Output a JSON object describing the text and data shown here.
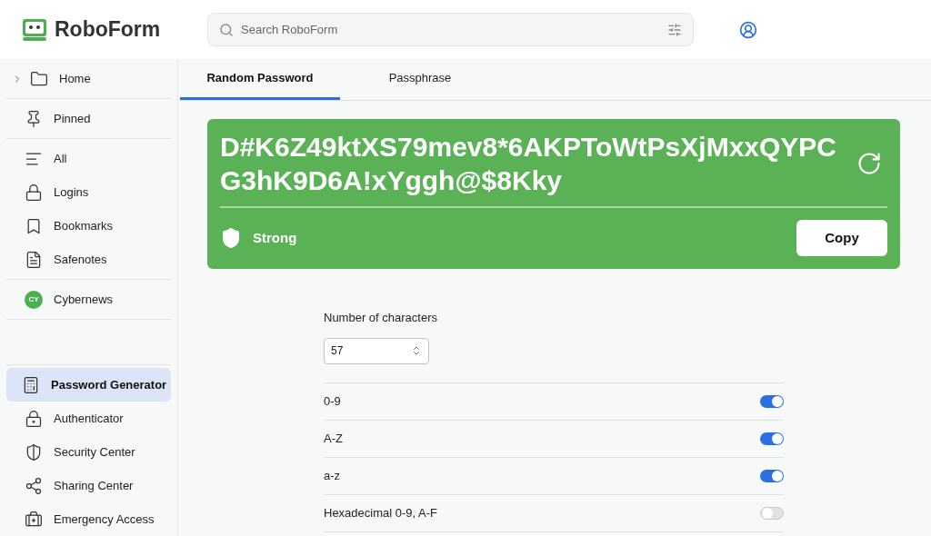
{
  "brand": "RoboForm",
  "search": {
    "placeholder": "Search RoboForm"
  },
  "sidebar": {
    "sections": [
      {
        "items": [
          {
            "label": "Home",
            "expandable": true,
            "selected": false
          }
        ]
      },
      {
        "items": [
          {
            "label": "Pinned",
            "expandable": false,
            "selected": false
          }
        ]
      },
      {
        "items": [
          {
            "label": "All",
            "expandable": false,
            "selected": false
          },
          {
            "label": "Logins",
            "expandable": false,
            "selected": false
          },
          {
            "label": "Bookmarks",
            "expandable": false,
            "selected": false
          },
          {
            "label": "Safenotes",
            "expandable": false,
            "selected": false
          }
        ]
      },
      {
        "items": [
          {
            "label": "Cybernews",
            "kind": "avatar",
            "avatar": "CY",
            "color": "#4caf50",
            "expandable": false,
            "selected": false
          }
        ]
      },
      {
        "items": [
          {
            "label": "Password Generator",
            "expandable": false,
            "selected": true
          },
          {
            "label": "Authenticator",
            "expandable": false,
            "selected": false
          },
          {
            "label": "Security Center",
            "expandable": false,
            "selected": false
          },
          {
            "label": "Sharing Center",
            "expandable": false,
            "selected": false
          },
          {
            "label": "Emergency Access",
            "expandable": false,
            "selected": false
          }
        ]
      }
    ]
  },
  "tabs": [
    {
      "label": "Random Password",
      "selected": true
    },
    {
      "label": "Passphrase",
      "selected": false
    }
  ],
  "generated": {
    "password": "D#K6Z49ktXS79mev8*6AKPToWtPsXjMxxQYPCG3hK9D6A!xYggh@$8Kky",
    "strength": "Strong",
    "copy": "Copy"
  },
  "length": {
    "label": "Number of characters",
    "value": "57"
  },
  "options": [
    {
      "label": "0-9",
      "on": true
    },
    {
      "label": "A-Z",
      "on": true
    },
    {
      "label": "a-z",
      "on": true
    },
    {
      "label": "Hexadecimal 0-9, A-F",
      "on": false
    }
  ]
}
